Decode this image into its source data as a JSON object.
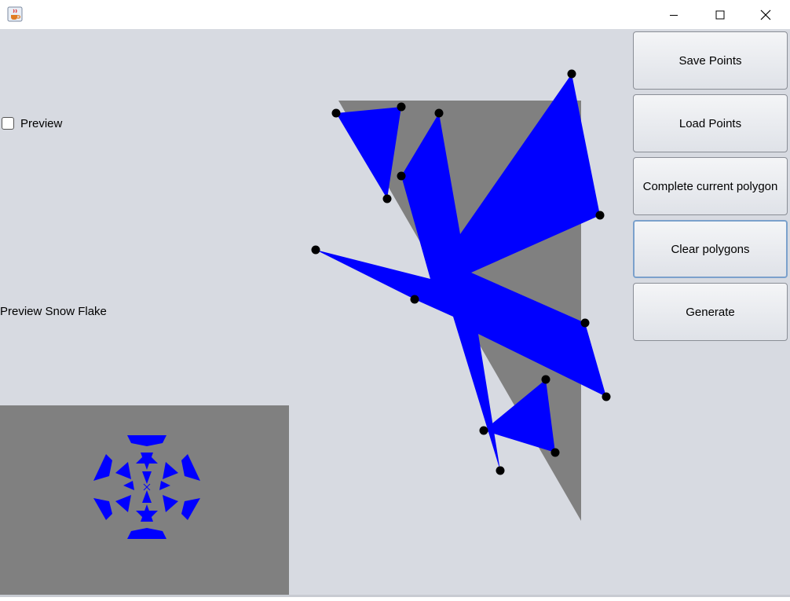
{
  "window": {
    "title_icon": "java-coffee-cup-icon",
    "minimize_icon": "minimize-icon",
    "maximize_icon": "maximize-icon",
    "close_icon": "close-icon"
  },
  "left_panel": {
    "preview_checkbox_label": "Preview",
    "preview_checked": false,
    "preview_title": "Preview Snow Flake"
  },
  "buttons": {
    "save": "Save Points",
    "load": "Load Points",
    "complete": "Complete current polygon",
    "clear": "Clear polygons",
    "generate": "Generate"
  },
  "colors": {
    "background": "#d7dae1",
    "template_triangle": "#808080",
    "polygon_fill": "#0000ff",
    "vertex_dot": "#000000",
    "preview_bg": "#808080"
  }
}
